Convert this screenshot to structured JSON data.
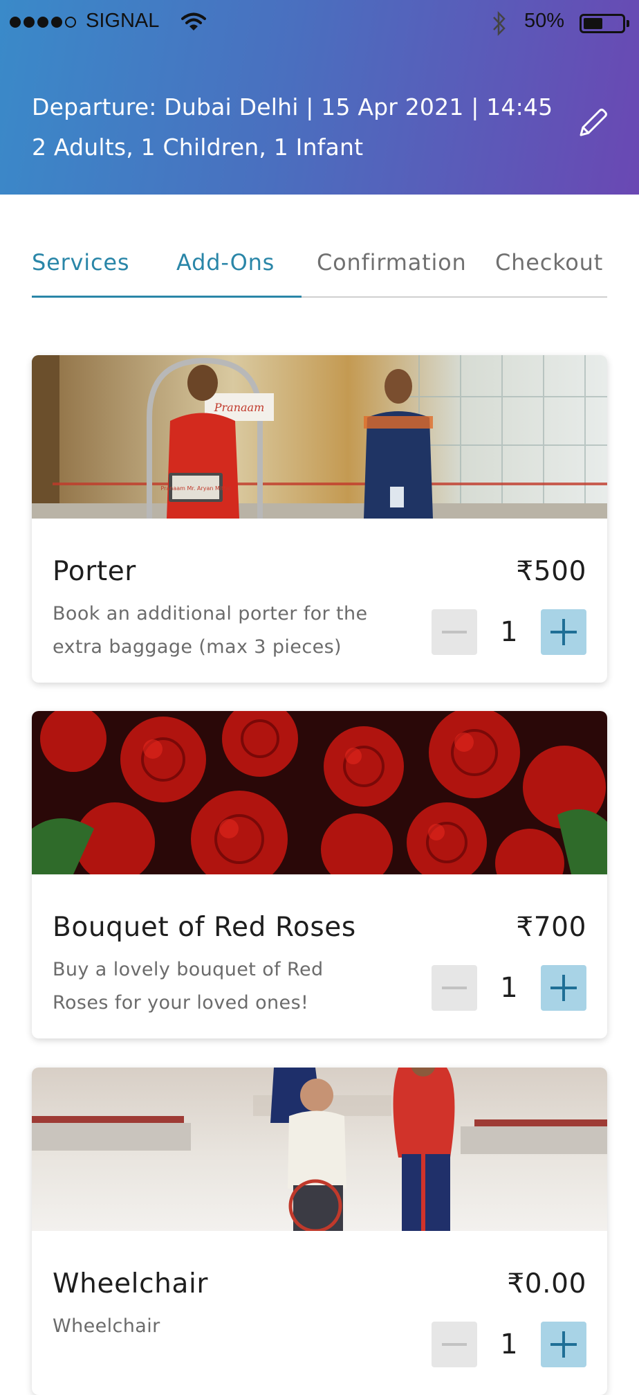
{
  "status_bar": {
    "carrier": "SIGNAL",
    "battery": "50%",
    "battery_level": 0.5
  },
  "trip": {
    "line1": "Departure: Dubai Delhi | 15 Apr 2021 | 14:45",
    "line2": "2 Adults, 1 Children, 1 Infant"
  },
  "tabs": [
    {
      "label": "Services",
      "active": true
    },
    {
      "label": "Add-Ons",
      "active": true
    },
    {
      "label": "Confirmation",
      "active": false
    },
    {
      "label": "Checkout",
      "active": false
    }
  ],
  "cards": [
    {
      "title": "Porter",
      "price": "₹500",
      "description": "Book an additional porter for the extra baggage (max 3 pieces)",
      "quantity": "1",
      "image_sign": "Pranaam",
      "image_tablet": "Pranaam Mr. Aryan Mittal"
    },
    {
      "title": "Bouquet of Red Roses",
      "price": "₹700",
      "description": "Buy a lovely bouquet of Red Roses for your loved ones!",
      "quantity": "1"
    },
    {
      "title": "Wheelchair",
      "price": "₹0.00",
      "description": "Wheelchair",
      "quantity": "1"
    }
  ],
  "colors": {
    "header_start": "#3a8ac9",
    "header_end": "#6a48b3",
    "accent": "#2a86a8",
    "plus_button": "#a8d3e6",
    "minus_button": "#e6e6e6"
  },
  "icons": [
    "signal-dots-icon",
    "wifi-icon",
    "bluetooth-icon",
    "battery-icon",
    "edit-pencil-icon",
    "minus-icon",
    "plus-icon"
  ]
}
